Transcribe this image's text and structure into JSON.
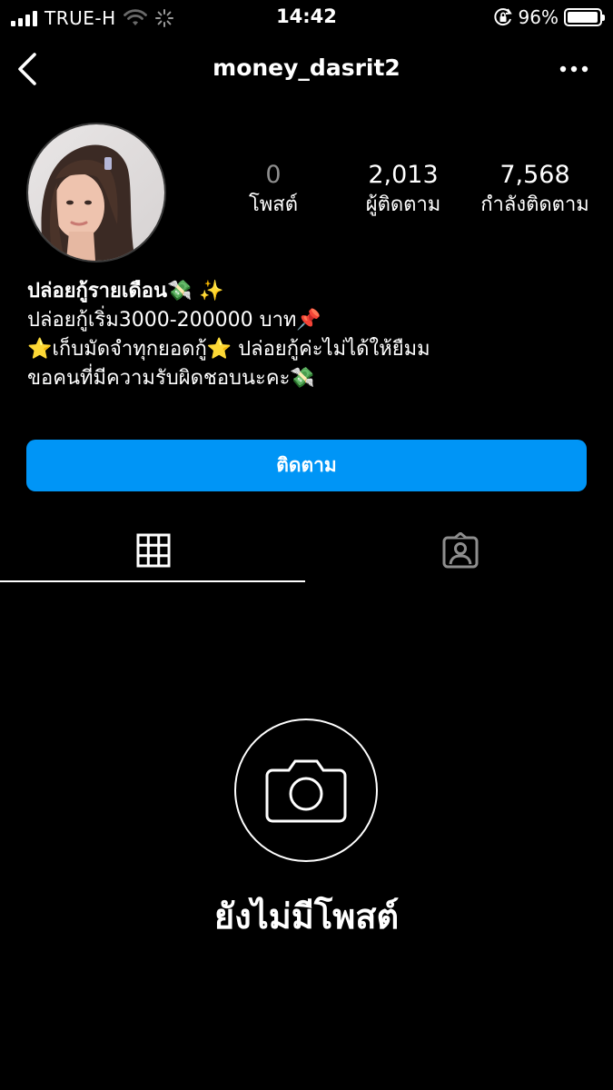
{
  "status_bar": {
    "carrier": "TRUE-H",
    "time": "14:42",
    "battery_percent": "96%",
    "battery_level": 0.96,
    "icons": [
      "signal-icon",
      "wifi-icon",
      "loading-icon",
      "orientation-lock-icon",
      "battery-icon"
    ]
  },
  "nav": {
    "username": "money_dasrit2",
    "back_icon": "chevron-left-icon",
    "more_icon": "more-horizontal-icon"
  },
  "profile": {
    "stats": [
      {
        "value": "0",
        "label": "โพสต์"
      },
      {
        "value": "2,013",
        "label": "ผู้ติดตาม"
      },
      {
        "value": "7,568",
        "label": "กำลังติดตาม"
      }
    ],
    "bio": {
      "name": "ปล่อยกู้รายเดือน💸 ✨",
      "lines": [
        "ปล่อยกู้เริ่ม3000-200000 บาท📌",
        "⭐เก็บมัดจำทุกยอดกู้⭐ ปล่อยกู้ค่ะไม่ได้ให้ยืมม",
        "ขอคนที่มีความรับผิดชอบนะคะ💸"
      ]
    },
    "follow_button": "ติดตาม"
  },
  "tabs": [
    {
      "icon": "grid-icon",
      "active": true
    },
    {
      "icon": "tagged-person-icon",
      "active": false
    }
  ],
  "empty_state": {
    "icon": "camera-icon",
    "text": "ยังไม่มีโพสต์"
  },
  "colors": {
    "background": "#000000",
    "accent": "#0095f6",
    "muted": "#8e8e8e"
  }
}
